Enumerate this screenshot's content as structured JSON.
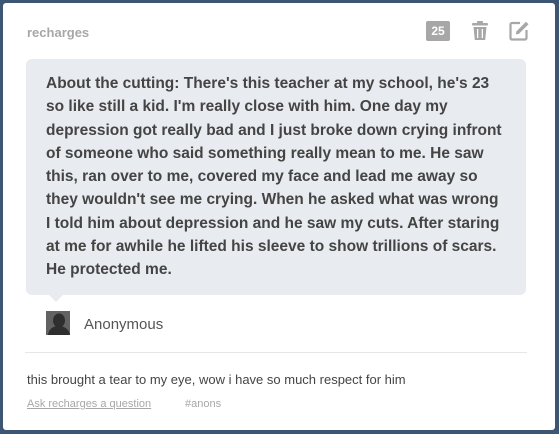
{
  "post": {
    "blog_name": "recharges",
    "notes_count": "25",
    "question_text": "About the cutting: There's this teacher at my school, he's 23 so like still a kid. I'm really close with him. One day my depression got really bad and I just broke down crying infront of someone who said something really mean to me. He saw this, ran over to me, covered my face and lead me away so they wouldn't see me crying. When he asked what was wrong I told him about depression and he saw my cuts. After staring at me for awhile he lifted his sleeve to show trillions of scars. He protected me.",
    "asker_name": "Anonymous",
    "answer_text": "this brought a tear to my eye, wow i have so much respect for him",
    "ask_link": "Ask recharges a question",
    "tag": "#anons"
  },
  "icons": {
    "delete": "trash-icon",
    "edit": "edit-icon",
    "avatar": "anonymous-avatar"
  },
  "colors": {
    "background": "#3c5674",
    "card": "#ffffff",
    "bubble": "#e8ebef",
    "muted": "#a7a7a7",
    "text": "#444444"
  }
}
